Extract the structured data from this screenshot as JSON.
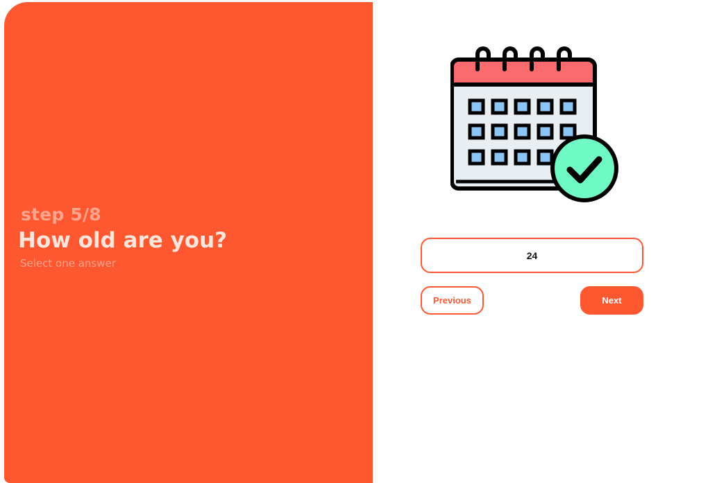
{
  "step": {
    "label": "step 5/8"
  },
  "question": {
    "title": "How old are you?",
    "hint": "Select one answer"
  },
  "illustration": {
    "icon": "calendar-check-icon"
  },
  "age_input": {
    "value": "24"
  },
  "nav": {
    "previous_label": "Previous",
    "next_label": "Next"
  },
  "colors": {
    "accent": "#ff572f",
    "calendar_header": "#fb6b6d",
    "calendar_body": "#e9eef2",
    "calendar_cells": "#8cc4f5",
    "check_badge": "#6ef9c5",
    "outline": "#000000"
  }
}
